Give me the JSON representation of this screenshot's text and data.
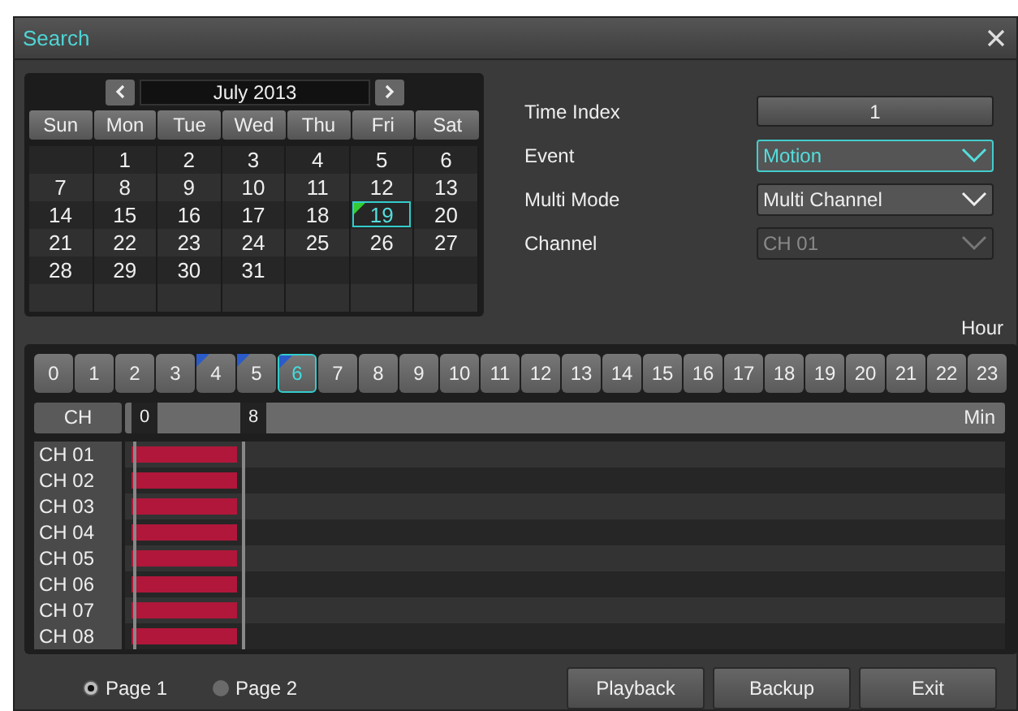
{
  "window": {
    "title": "Search"
  },
  "calendar": {
    "month_label": "July 2013",
    "weekdays": [
      "Sun",
      "Mon",
      "Tue",
      "Wed",
      "Thu",
      "Fri",
      "Sat"
    ],
    "weeks": [
      [
        {
          "day": "1",
          "selected": false
        },
        {
          "day": "2",
          "selected": false
        },
        {
          "day": "3",
          "selected": false
        },
        {
          "day": "4",
          "selected": false
        },
        {
          "day": "5",
          "selected": false
        },
        {
          "day": "6",
          "selected": false
        }
      ],
      [
        {
          "day": "7",
          "selected": false
        },
        {
          "day": "8",
          "selected": false
        },
        {
          "day": "9",
          "selected": false
        },
        {
          "day": "10",
          "selected": false
        },
        {
          "day": "11",
          "selected": false
        },
        {
          "day": "12",
          "selected": false
        },
        {
          "day": "13",
          "selected": false
        }
      ],
      [
        {
          "day": "14",
          "selected": false
        },
        {
          "day": "15",
          "selected": false
        },
        {
          "day": "16",
          "selected": false
        },
        {
          "day": "17",
          "selected": false
        },
        {
          "day": "18",
          "selected": false
        },
        {
          "day": "19",
          "selected": true
        },
        {
          "day": "20",
          "selected": false
        }
      ],
      [
        {
          "day": "21",
          "selected": false
        },
        {
          "day": "22",
          "selected": false
        },
        {
          "day": "23",
          "selected": false
        },
        {
          "day": "24",
          "selected": false
        },
        {
          "day": "25",
          "selected": false
        },
        {
          "day": "26",
          "selected": false
        },
        {
          "day": "27",
          "selected": false
        }
      ],
      [
        {
          "day": "28",
          "selected": false
        },
        {
          "day": "29",
          "selected": false
        },
        {
          "day": "30",
          "selected": false
        },
        {
          "day": "31",
          "selected": false
        }
      ]
    ]
  },
  "settings": [
    {
      "kind": "button",
      "label": "Time Index",
      "value": "1",
      "focused": false,
      "disabled": false
    },
    {
      "kind": "dropdown",
      "label": "Event",
      "value": "Motion",
      "focused": true,
      "disabled": false
    },
    {
      "kind": "dropdown",
      "label": "Multi Mode",
      "value": "Multi Channel",
      "focused": false,
      "disabled": false
    },
    {
      "kind": "dropdown",
      "label": "Channel",
      "value": "CH 01",
      "focused": false,
      "disabled": true
    }
  ],
  "hour_label": "Hour",
  "hours": [
    {
      "label": "0",
      "selected": false,
      "recorded": false
    },
    {
      "label": "1",
      "selected": false,
      "recorded": false
    },
    {
      "label": "2",
      "selected": false,
      "recorded": false
    },
    {
      "label": "3",
      "selected": false,
      "recorded": false
    },
    {
      "label": "4",
      "selected": false,
      "recorded": true
    },
    {
      "label": "5",
      "selected": false,
      "recorded": true
    },
    {
      "label": "6",
      "selected": true,
      "recorded": true
    },
    {
      "label": "7",
      "selected": false,
      "recorded": false
    },
    {
      "label": "8",
      "selected": false,
      "recorded": false
    },
    {
      "label": "9",
      "selected": false,
      "recorded": false
    },
    {
      "label": "10",
      "selected": false,
      "recorded": false
    },
    {
      "label": "11",
      "selected": false,
      "recorded": false
    },
    {
      "label": "12",
      "selected": false,
      "recorded": false
    },
    {
      "label": "13",
      "selected": false,
      "recorded": false
    },
    {
      "label": "14",
      "selected": false,
      "recorded": false
    },
    {
      "label": "15",
      "selected": false,
      "recorded": false
    },
    {
      "label": "16",
      "selected": false,
      "recorded": false
    },
    {
      "label": "17",
      "selected": false,
      "recorded": false
    },
    {
      "label": "18",
      "selected": false,
      "recorded": false
    },
    {
      "label": "19",
      "selected": false,
      "recorded": false
    },
    {
      "label": "20",
      "selected": false,
      "recorded": false
    },
    {
      "label": "21",
      "selected": false,
      "recorded": false
    },
    {
      "label": "22",
      "selected": false,
      "recorded": false
    },
    {
      "label": "23",
      "selected": false,
      "recorded": false
    }
  ],
  "timeline": {
    "ch_label": "CH",
    "markers": [
      "0",
      "8"
    ],
    "unit_label": "Min",
    "channels": [
      {
        "name": "CH 01",
        "level": 0.12
      },
      {
        "name": "CH 02",
        "level": 0.12
      },
      {
        "name": "CH 03",
        "level": 0.12
      },
      {
        "name": "CH 04",
        "level": 0.12
      },
      {
        "name": "CH 05",
        "level": 0.12
      },
      {
        "name": "CH 06",
        "level": 0.12
      },
      {
        "name": "CH 07",
        "level": 0.12
      },
      {
        "name": "CH 08",
        "level": 0.12
      }
    ]
  },
  "pages": [
    {
      "label": "Page 1",
      "selected": true
    },
    {
      "label": "Page 2",
      "selected": false
    }
  ],
  "buttons": [
    "Playback",
    "Backup",
    "Exit"
  ]
}
